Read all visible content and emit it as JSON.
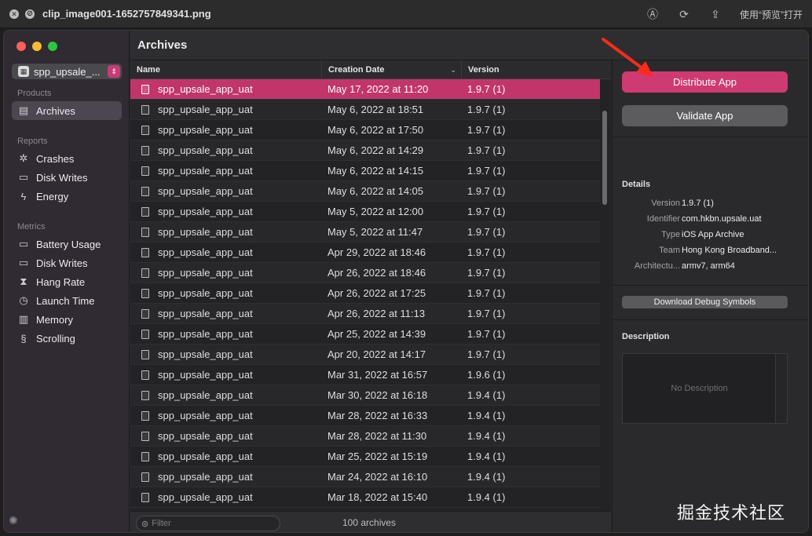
{
  "preview": {
    "title": "clip_image001-1652757849341.png",
    "open_label": "使用“预览”打开"
  },
  "sidebar": {
    "product_name": "spp_upsale_...",
    "products_header": "Products",
    "archives_label": "Archives",
    "reports_header": "Reports",
    "reports": [
      {
        "label": "Crashes",
        "icon": "crash-icon"
      },
      {
        "label": "Disk Writes",
        "icon": "disk-icon"
      },
      {
        "label": "Energy",
        "icon": "energy-icon"
      }
    ],
    "metrics_header": "Metrics",
    "metrics": [
      {
        "label": "Battery Usage",
        "icon": "battery-icon"
      },
      {
        "label": "Disk Writes",
        "icon": "disk-icon"
      },
      {
        "label": "Hang Rate",
        "icon": "hourglass-icon"
      },
      {
        "label": "Launch Time",
        "icon": "clock-icon"
      },
      {
        "label": "Memory",
        "icon": "memory-icon"
      },
      {
        "label": "Scrolling",
        "icon": "scroll-icon"
      }
    ]
  },
  "header": {
    "title": "Archives"
  },
  "table": {
    "columns": {
      "name": "Name",
      "date": "Creation Date",
      "version": "Version"
    },
    "rows": [
      {
        "name": "spp_upsale_app_uat",
        "date": "May 17, 2022 at 11:20",
        "version": "1.9.7 (1)"
      },
      {
        "name": "spp_upsale_app_uat",
        "date": "May 6, 2022 at 18:51",
        "version": "1.9.7 (1)"
      },
      {
        "name": "spp_upsale_app_uat",
        "date": "May 6, 2022 at 17:50",
        "version": "1.9.7 (1)"
      },
      {
        "name": "spp_upsale_app_uat",
        "date": "May 6, 2022 at 14:29",
        "version": "1.9.7 (1)"
      },
      {
        "name": "spp_upsale_app_uat",
        "date": "May 6, 2022 at 14:15",
        "version": "1.9.7 (1)"
      },
      {
        "name": "spp_upsale_app_uat",
        "date": "May 6, 2022 at 14:05",
        "version": "1.9.7 (1)"
      },
      {
        "name": "spp_upsale_app_uat",
        "date": "May 5, 2022 at 12:00",
        "version": "1.9.7 (1)"
      },
      {
        "name": "spp_upsale_app_uat",
        "date": "May 5, 2022 at 11:47",
        "version": "1.9.7 (1)"
      },
      {
        "name": "spp_upsale_app_uat",
        "date": "Apr 29, 2022 at 18:46",
        "version": "1.9.7 (1)"
      },
      {
        "name": "spp_upsale_app_uat",
        "date": "Apr 26, 2022 at 18:46",
        "version": "1.9.7 (1)"
      },
      {
        "name": "spp_upsale_app_uat",
        "date": "Apr 26, 2022 at 17:25",
        "version": "1.9.7 (1)"
      },
      {
        "name": "spp_upsale_app_uat",
        "date": "Apr 26, 2022 at 11:13",
        "version": "1.9.7 (1)"
      },
      {
        "name": "spp_upsale_app_uat",
        "date": "Apr 25, 2022 at 14:39",
        "version": "1.9.7 (1)"
      },
      {
        "name": "spp_upsale_app_uat",
        "date": "Apr 20, 2022 at 14:17",
        "version": "1.9.7 (1)"
      },
      {
        "name": "spp_upsale_app_uat",
        "date": "Mar 31, 2022 at 16:57",
        "version": "1.9.6 (1)"
      },
      {
        "name": "spp_upsale_app_uat",
        "date": "Mar 30, 2022 at 16:18",
        "version": "1.9.4 (1)"
      },
      {
        "name": "spp_upsale_app_uat",
        "date": "Mar 28, 2022 at 16:33",
        "version": "1.9.4 (1)"
      },
      {
        "name": "spp_upsale_app_uat",
        "date": "Mar 28, 2022 at 11:30",
        "version": "1.9.4 (1)"
      },
      {
        "name": "spp_upsale_app_uat",
        "date": "Mar 25, 2022 at 15:19",
        "version": "1.9.4 (1)"
      },
      {
        "name": "spp_upsale_app_uat",
        "date": "Mar 24, 2022 at 16:10",
        "version": "1.9.4 (1)"
      },
      {
        "name": "spp_upsale_app_uat",
        "date": "Mar 18, 2022 at 15:40",
        "version": "1.9.4 (1)"
      }
    ]
  },
  "bottom": {
    "filter_placeholder": "Filter",
    "count": "100 archives"
  },
  "panel": {
    "distribute_label": "Distribute App",
    "validate_label": "Validate App",
    "details_header": "Details",
    "details": [
      {
        "key": "Version",
        "value": "1.9.7 (1)"
      },
      {
        "key": "Identifier",
        "value": "com.hkbn.upsale.uat"
      },
      {
        "key": "Type",
        "value": "iOS App Archive"
      },
      {
        "key": "Team",
        "value": "Hong Kong Broadband..."
      },
      {
        "key": "Architectu...",
        "value": "armv7, arm64"
      }
    ],
    "debug_symbols_label": "Download Debug Symbols",
    "description_header": "Description",
    "description_placeholder": "No Description"
  },
  "watermark": "掘金技术社区",
  "colors": {
    "accent": "#cf3a72",
    "selection": "#c2356a"
  }
}
